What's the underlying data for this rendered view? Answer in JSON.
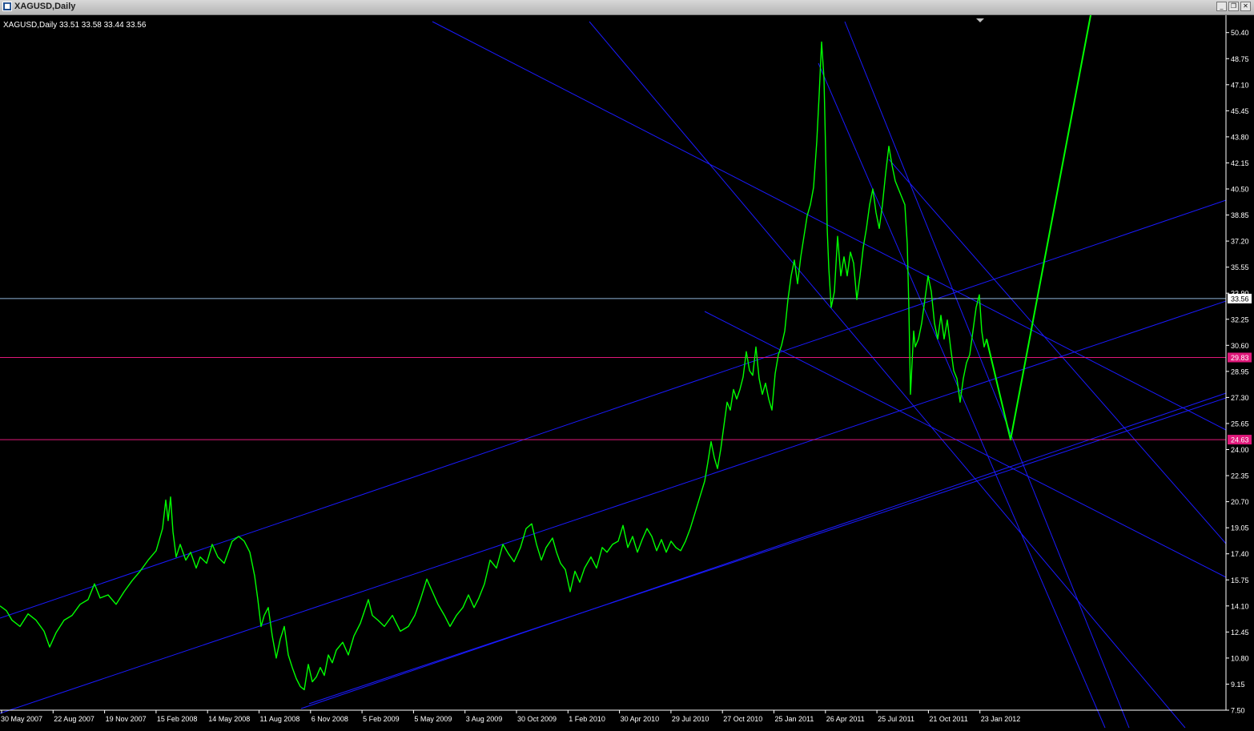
{
  "window": {
    "title": "XAGUSD,Daily",
    "buttons": [
      "minimize",
      "restore",
      "close"
    ]
  },
  "chart_data": {
    "type": "line",
    "title": "XAGUSD,Daily",
    "ohlc": "33.51 33.58 33.44 33.56",
    "colors": {
      "background": "#000000",
      "price": "#00ff00",
      "trendlines": "#1a1aff",
      "level_line": "#e0187a",
      "current_price_line": "#8fb4d8",
      "axis_text": "#ffffff"
    },
    "y_axis": {
      "position": "right",
      "ylim": [
        7.5,
        51.5
      ],
      "ticks": [
        "50.40",
        "48.75",
        "47.10",
        "45.45",
        "43.80",
        "42.15",
        "40.50",
        "38.85",
        "37.20",
        "35.55",
        "33.90",
        "32.25",
        "30.60",
        "28.95",
        "27.30",
        "25.65",
        "24.00",
        "22.35",
        "20.70",
        "19.05",
        "17.40",
        "15.75",
        "14.10",
        "12.45",
        "10.80",
        "9.15",
        "7.50"
      ]
    },
    "x_axis": {
      "ticks": [
        "30 May 2007",
        "22 Aug 2007",
        "19 Nov 2007",
        "15 Feb 2008",
        "14 May 2008",
        "11 Aug 2008",
        "6 Nov 2008",
        "5 Feb 2009",
        "5 May 2009",
        "3 Aug 2009",
        "30 Oct 2009",
        "1 Feb 2010",
        "30 Apr 2010",
        "29 Jul 2010",
        "27 Oct 2010",
        "25 Jan 2011",
        "26 Apr 2011",
        "25 Jul 2011",
        "21 Oct 2011",
        "23 Jan 2012"
      ]
    },
    "price_labels": [
      {
        "value": 33.56,
        "label": "33.56",
        "kind": "current"
      },
      {
        "value": 29.83,
        "label": "29.83",
        "kind": "level"
      },
      {
        "value": 24.63,
        "label": "24.63",
        "kind": "level"
      }
    ],
    "series": [
      {
        "kind": "price",
        "points": [
          [
            0,
            14.1
          ],
          [
            8,
            13.8
          ],
          [
            15,
            13.2
          ],
          [
            25,
            12.8
          ],
          [
            35,
            13.6
          ],
          [
            45,
            13.2
          ],
          [
            55,
            12.5
          ],
          [
            62,
            11.5
          ],
          [
            70,
            12.4
          ],
          [
            80,
            13.2
          ],
          [
            90,
            13.5
          ],
          [
            100,
            14.2
          ],
          [
            110,
            14.5
          ],
          [
            118,
            15.5
          ],
          [
            125,
            14.6
          ],
          [
            135,
            14.8
          ],
          [
            145,
            14.2
          ],
          [
            155,
            15.0
          ],
          [
            165,
            15.7
          ],
          [
            175,
            16.3
          ],
          [
            185,
            17.0
          ],
          [
            195,
            17.6
          ],
          [
            203,
            19.0
          ],
          [
            207,
            20.8
          ],
          [
            210,
            19.5
          ],
          [
            213,
            21.0
          ],
          [
            216,
            18.8
          ],
          [
            220,
            17.2
          ],
          [
            225,
            18.0
          ],
          [
            232,
            17.0
          ],
          [
            238,
            17.5
          ],
          [
            245,
            16.5
          ],
          [
            250,
            17.2
          ],
          [
            258,
            16.8
          ],
          [
            265,
            18.0
          ],
          [
            272,
            17.2
          ],
          [
            280,
            16.8
          ],
          [
            290,
            18.2
          ],
          [
            298,
            18.5
          ],
          [
            305,
            18.2
          ],
          [
            312,
            17.5
          ],
          [
            318,
            16.0
          ],
          [
            322,
            14.5
          ],
          [
            326,
            12.8
          ],
          [
            330,
            13.5
          ],
          [
            335,
            14.0
          ],
          [
            340,
            12.2
          ],
          [
            345,
            10.8
          ],
          [
            350,
            12.0
          ],
          [
            355,
            12.8
          ],
          [
            360,
            11.0
          ],
          [
            365,
            10.2
          ],
          [
            370,
            9.5
          ],
          [
            375,
            9.0
          ],
          [
            380,
            8.8
          ],
          [
            385,
            10.4
          ],
          [
            390,
            9.3
          ],
          [
            395,
            9.6
          ],
          [
            400,
            10.2
          ],
          [
            405,
            9.7
          ],
          [
            410,
            11.0
          ],
          [
            415,
            10.5
          ],
          [
            420,
            11.3
          ],
          [
            428,
            11.8
          ],
          [
            435,
            11.0
          ],
          [
            442,
            12.2
          ],
          [
            450,
            13.0
          ],
          [
            460,
            14.5
          ],
          [
            465,
            13.5
          ],
          [
            472,
            13.2
          ],
          [
            480,
            12.8
          ],
          [
            490,
            13.5
          ],
          [
            500,
            12.5
          ],
          [
            510,
            12.8
          ],
          [
            518,
            13.5
          ],
          [
            525,
            14.5
          ],
          [
            533,
            15.8
          ],
          [
            540,
            15.0
          ],
          [
            547,
            14.2
          ],
          [
            555,
            13.5
          ],
          [
            562,
            12.8
          ],
          [
            570,
            13.5
          ],
          [
            578,
            14.0
          ],
          [
            585,
            14.8
          ],
          [
            592,
            14.0
          ],
          [
            598,
            14.6
          ],
          [
            605,
            15.5
          ],
          [
            612,
            17.0
          ],
          [
            620,
            16.5
          ],
          [
            628,
            18.0
          ],
          [
            635,
            17.4
          ],
          [
            642,
            16.9
          ],
          [
            650,
            17.8
          ],
          [
            657,
            19.0
          ],
          [
            664,
            19.3
          ],
          [
            670,
            18.0
          ],
          [
            676,
            17.0
          ],
          [
            682,
            17.8
          ],
          [
            690,
            18.4
          ],
          [
            695,
            17.5
          ],
          [
            700,
            16.8
          ],
          [
            706,
            16.4
          ],
          [
            712,
            15.0
          ],
          [
            718,
            16.3
          ],
          [
            724,
            15.6
          ],
          [
            730,
            16.5
          ],
          [
            738,
            17.2
          ],
          [
            745,
            16.5
          ],
          [
            752,
            17.8
          ],
          [
            758,
            17.5
          ],
          [
            765,
            18.0
          ],
          [
            772,
            18.2
          ],
          [
            778,
            19.2
          ],
          [
            784,
            17.8
          ],
          [
            790,
            18.5
          ],
          [
            796,
            17.5
          ],
          [
            802,
            18.3
          ],
          [
            808,
            19.0
          ],
          [
            814,
            18.5
          ],
          [
            820,
            17.6
          ],
          [
            826,
            18.3
          ],
          [
            832,
            17.5
          ],
          [
            838,
            18.2
          ],
          [
            844,
            17.8
          ],
          [
            850,
            17.6
          ],
          [
            856,
            18.2
          ],
          [
            862,
            19.0
          ],
          [
            868,
            20.0
          ],
          [
            874,
            21.0
          ],
          [
            880,
            22.0
          ],
          [
            884,
            23.2
          ],
          [
            888,
            24.5
          ],
          [
            892,
            23.5
          ],
          [
            896,
            22.8
          ],
          [
            900,
            24.0
          ],
          [
            904,
            25.5
          ],
          [
            908,
            27.0
          ],
          [
            912,
            26.5
          ],
          [
            916,
            27.8
          ],
          [
            920,
            27.2
          ],
          [
            924,
            27.8
          ],
          [
            928,
            28.6
          ],
          [
            932,
            30.2
          ],
          [
            936,
            29.0
          ],
          [
            940,
            28.7
          ],
          [
            944,
            30.5
          ],
          [
            948,
            28.5
          ],
          [
            952,
            27.5
          ],
          [
            956,
            28.2
          ],
          [
            960,
            27.2
          ],
          [
            964,
            26.5
          ],
          [
            968,
            28.8
          ],
          [
            972,
            30.0
          ],
          [
            976,
            30.6
          ],
          [
            980,
            31.5
          ],
          [
            984,
            33.5
          ],
          [
            988,
            35.0
          ],
          [
            992,
            36.0
          ],
          [
            996,
            34.5
          ],
          [
            1000,
            36.2
          ],
          [
            1004,
            37.5
          ],
          [
            1008,
            38.8
          ],
          [
            1012,
            39.5
          ],
          [
            1016,
            40.6
          ],
          [
            1020,
            43.5
          ],
          [
            1023,
            46.5
          ],
          [
            1026,
            49.8
          ],
          [
            1029,
            47.5
          ],
          [
            1031,
            43.0
          ],
          [
            1033,
            38.0
          ],
          [
            1035,
            35.5
          ],
          [
            1038,
            33.0
          ],
          [
            1042,
            34.0
          ],
          [
            1046,
            37.5
          ],
          [
            1050,
            35.0
          ],
          [
            1054,
            36.2
          ],
          [
            1058,
            35.0
          ],
          [
            1062,
            36.5
          ],
          [
            1066,
            35.8
          ],
          [
            1070,
            33.5
          ],
          [
            1074,
            35.0
          ],
          [
            1078,
            36.8
          ],
          [
            1082,
            38.0
          ],
          [
            1086,
            39.5
          ],
          [
            1090,
            40.5
          ],
          [
            1094,
            39.0
          ],
          [
            1098,
            38.0
          ],
          [
            1102,
            39.5
          ],
          [
            1106,
            41.5
          ],
          [
            1110,
            43.2
          ],
          [
            1114,
            42.0
          ],
          [
            1118,
            41.0
          ],
          [
            1122,
            40.5
          ],
          [
            1126,
            40.0
          ],
          [
            1130,
            39.5
          ],
          [
            1133,
            37.0
          ],
          [
            1135,
            33.0
          ],
          [
            1137,
            27.5
          ],
          [
            1139,
            29.5
          ],
          [
            1141,
            31.5
          ],
          [
            1143,
            30.5
          ],
          [
            1147,
            31.0
          ],
          [
            1151,
            32.0
          ],
          [
            1155,
            33.5
          ],
          [
            1159,
            35.0
          ],
          [
            1163,
            34.0
          ],
          [
            1167,
            32.0
          ],
          [
            1171,
            31.0
          ],
          [
            1175,
            32.5
          ],
          [
            1179,
            31.0
          ],
          [
            1183,
            32.2
          ],
          [
            1187,
            30.5
          ],
          [
            1191,
            29.0
          ],
          [
            1195,
            28.5
          ],
          [
            1199,
            27.0
          ],
          [
            1203,
            28.5
          ],
          [
            1207,
            29.5
          ],
          [
            1211,
            30.0
          ],
          [
            1215,
            31.5
          ],
          [
            1219,
            33.0
          ],
          [
            1223,
            33.8
          ],
          [
            1226,
            31.5
          ],
          [
            1229,
            30.5
          ],
          [
            1232,
            31.0
          ]
        ]
      },
      {
        "kind": "projection",
        "points": [
          [
            1232,
            31.0
          ],
          [
            1262,
            24.63
          ],
          [
            1362,
            51.5
          ]
        ]
      }
    ]
  }
}
